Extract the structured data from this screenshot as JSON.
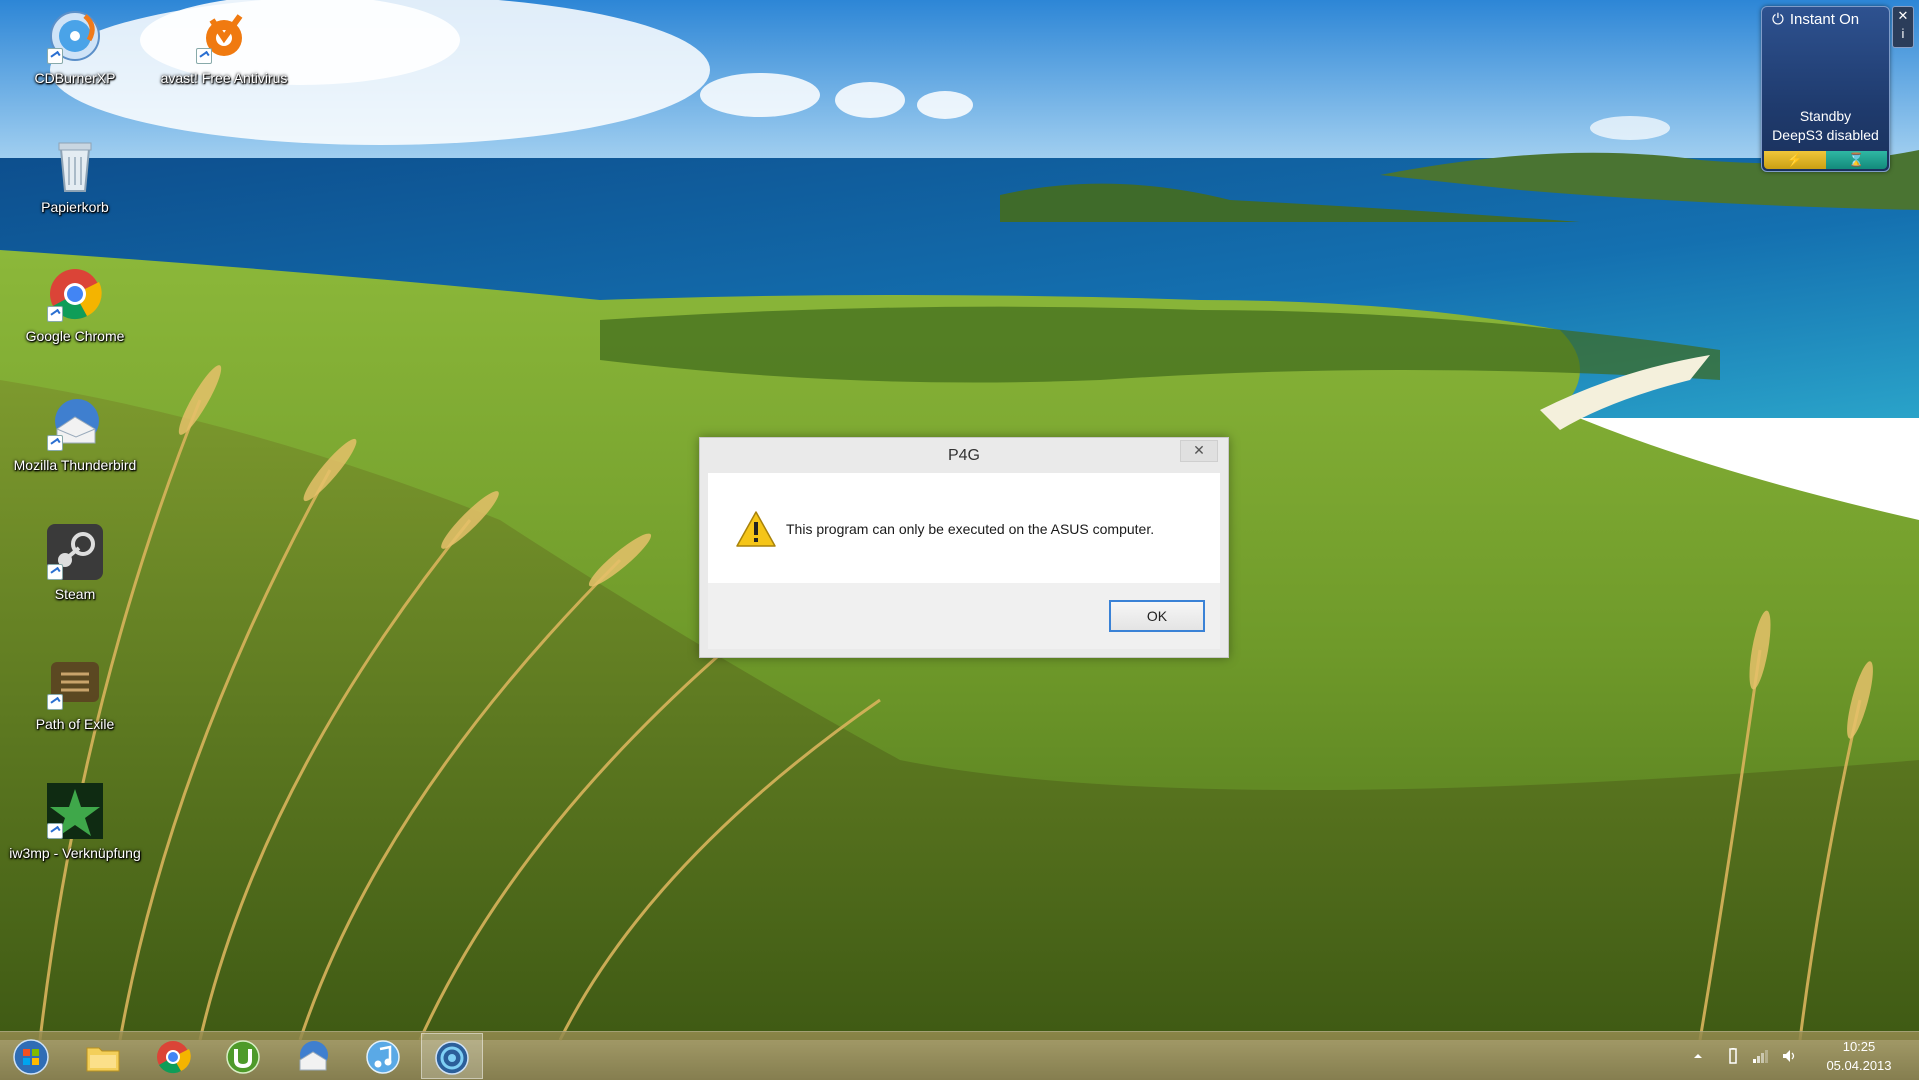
{
  "desktop": {
    "icons": [
      {
        "label": "CDBurnerXP",
        "icon": "cd-burner-icon"
      },
      {
        "label": "avast! Free Antivirus",
        "icon": "avast-icon"
      },
      {
        "label": "Papierkorb",
        "icon": "recycle-bin-icon"
      },
      {
        "label": "Google Chrome",
        "icon": "chrome-icon"
      },
      {
        "label": "Mozilla Thunderbird",
        "icon": "thunderbird-icon"
      },
      {
        "label": "Steam",
        "icon": "steam-icon"
      },
      {
        "label": "Path of Exile",
        "icon": "path-of-exile-icon"
      },
      {
        "label": "iw3mp - Verknüpfung",
        "icon": "iw3mp-icon"
      }
    ]
  },
  "gadget": {
    "title": "Instant On",
    "status_line1": "Standby",
    "status_line2": "DeepS3 disabled",
    "side_close": "✕",
    "side_info": "i"
  },
  "dialog": {
    "title": "P4G",
    "close_label": "✕",
    "message": "This program can only be executed on the ASUS computer.",
    "ok_label": "OK"
  },
  "taskbar": {
    "items": [
      "start-orb",
      "file-explorer",
      "google-chrome",
      "utorrent",
      "thunderbird",
      "itunes",
      "p4g-app"
    ],
    "active": "p4g-app"
  },
  "clock": {
    "time": "10:25",
    "date": "05.04.2013"
  }
}
